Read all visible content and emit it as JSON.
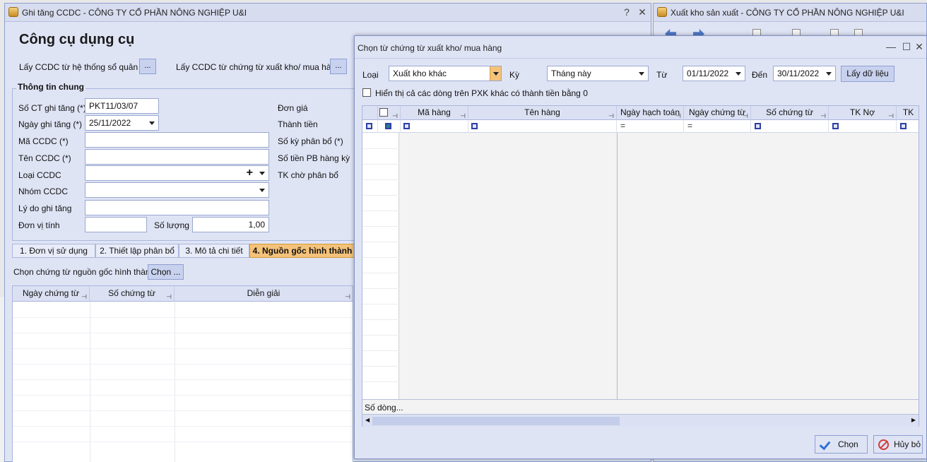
{
  "main_window": {
    "title": "Ghi tăng CCDC - CÔNG TY CỔ PHẦN NÔNG NGHIỆP U&I",
    "help": "?",
    "close": "✕",
    "heading": "Công cụ dụng cụ",
    "get_from_system_label": "Lấy CCDC từ hệ thống sổ quản trị",
    "get_from_voucher_label": "Lấy CCDC từ chứng từ xuất kho/ mua hàng",
    "dots": "...",
    "general_info": "Thông tin chung",
    "fields": {
      "so_ct_label": "Số CT ghi tăng (*)",
      "so_ct_value": "PKT11/03/07",
      "ngay_label": "Ngày ghi tăng (*)",
      "ngay_value": "25/11/2022",
      "ma_label": "Mã CCDC (*)",
      "ten_label": "Tên CCDC (*)",
      "loai_label": "Loại CCDC",
      "nhom_label": "Nhóm CCDC",
      "ly_do_label": "Lý do ghi tăng",
      "don_vi_label": "Đơn vị tính",
      "so_luong_label": "Số lượng",
      "so_luong_value": "1,00",
      "don_gia_label": "Đơn giá",
      "thanh_tien_label": "Thành tiền",
      "so_ky_label": "Số kỳ phân bổ (*)",
      "so_tien_pb_label": "Số tiền PB hàng kỳ",
      "tk_cho_label": "TK chờ phân bổ"
    },
    "tabs": [
      "1. Đơn vị sử dụng",
      "2. Thiết lập phân bổ",
      "3. Mô tả chi tiết",
      "4. Nguồn gốc hình thành"
    ],
    "choose_label": "Chọn chứng từ nguồn gốc hình thành",
    "choose_button": "Chọn ...",
    "grid_columns": [
      "Ngày chứng từ",
      "Số chứng từ",
      "Diễn giải"
    ]
  },
  "back_window": {
    "title": "Xuất kho sản xuất - CÔNG TY CỔ PHẦN NÔNG NGHIỆP U&I"
  },
  "dialog": {
    "title": "Chọn từ chứng từ xuất kho/ mua hàng",
    "minimize": "—",
    "maximize": "☐",
    "close": "✕",
    "loai_label": "Loại",
    "loai_value": "Xuất kho khác",
    "ky_label": "Kỳ",
    "ky_value": "Tháng này",
    "tu_label": "Từ",
    "tu_value": "01/11/2022",
    "den_label": "Đến",
    "den_value": "30/11/2022",
    "get_data_button": "Lấy dữ liệu",
    "show_all_label": "Hiển thị cả các dòng trên PXK khác có thành tiền bằng 0",
    "columns": [
      "Mã hàng",
      "Tên hàng",
      "Ngày hạch toán",
      "Ngày chứng từ",
      "Số chứng từ",
      "TK Nợ",
      "TK"
    ],
    "footer_label": "Số dòng...",
    "ok_button": "Chọn",
    "cancel_button": "Hủy bỏ"
  },
  "accent_colors": {
    "active_tab": "#f4c27a",
    "window_bg": "#dfe4f5",
    "cancel_red": "#d43a3a"
  }
}
